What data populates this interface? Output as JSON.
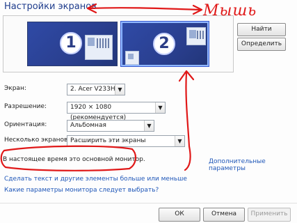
{
  "window": {
    "title": "Настройки экранов"
  },
  "preview": {
    "monitors": [
      {
        "number": "1"
      },
      {
        "number": "2"
      }
    ]
  },
  "buttons": {
    "find": "Найти",
    "detect": "Определить",
    "ok": "ОК",
    "cancel": "Отмена",
    "apply": "Применить"
  },
  "form": {
    "screen": {
      "label": "Экран:",
      "value": "2. Acer V233H"
    },
    "resolution": {
      "label": "Разрешение:",
      "value": "1920 × 1080 (рекомендуется)"
    },
    "orientation": {
      "label": "Ориентация:",
      "value": "Альбомная"
    },
    "multiple": {
      "label": "Несколько экранов:",
      "value": "Расширить эти экраны"
    }
  },
  "status_text": "В настоящее время это основной монитор.",
  "links": {
    "advanced": "Дополнительные параметры",
    "bigger": "Сделать текст и другие элементы больше или меньше",
    "which": "Какие параметры монитора следует выбрать?"
  },
  "annotation": {
    "handwriting": "Мышь",
    "color": "#e01818"
  },
  "colors": {
    "monitor_blue": "#2f4aa6",
    "link_blue": "#1e56b8",
    "title_blue": "#1e3c8c"
  }
}
